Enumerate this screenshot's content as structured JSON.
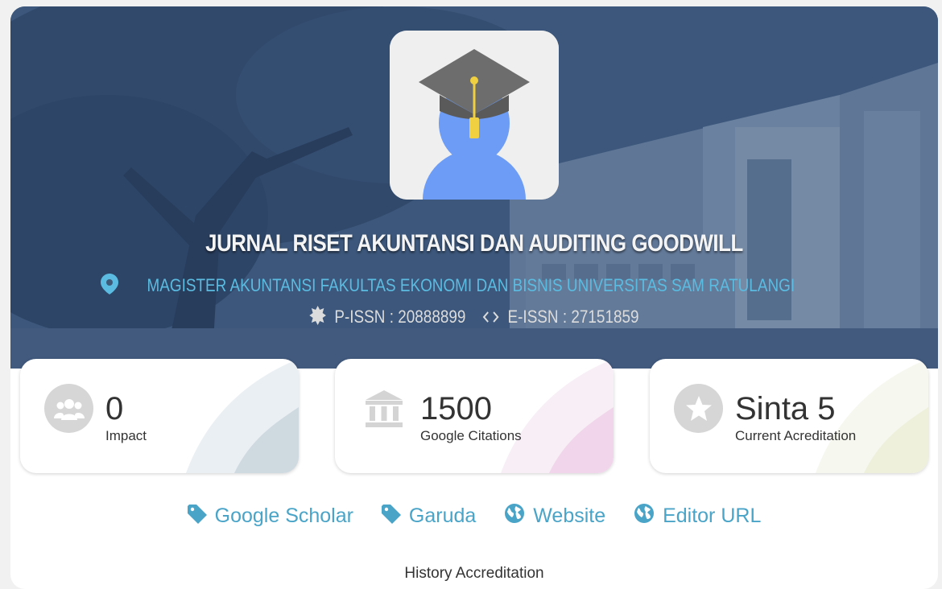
{
  "journal": {
    "title": "JURNAL RISET AKUNTANSI DAN AUDITING GOODWILL",
    "affiliation": "MAGISTER AKUNTANSI FAKULTAS EKONOMI DAN BISNIS UNIVERSITAS SAM RATULANGI",
    "p_issn": "P-ISSN : 20888899",
    "e_issn": "E-ISSN : 27151859"
  },
  "stats": [
    {
      "value": "0",
      "label": "Impact",
      "icon": "users-icon",
      "color": "#cfd9e0"
    },
    {
      "value": "1500",
      "label": "Google Citations",
      "icon": "bank-icon",
      "color": "#f1d5ea"
    },
    {
      "value": "Sinta 5",
      "label": "Current Acreditation",
      "icon": "star-icon",
      "color": "#eef0dc"
    }
  ],
  "links": [
    {
      "label": "Google Scholar",
      "icon": "tag-icon"
    },
    {
      "label": "Garuda",
      "icon": "tag-icon"
    },
    {
      "label": "Website",
      "icon": "globe-icon"
    },
    {
      "label": "Editor URL",
      "icon": "globe-icon"
    }
  ],
  "history_label": "History Accreditation",
  "colors": {
    "accent": "#49a4c8",
    "affiliation": "#5bbbe0",
    "hero": "#3f5a78"
  }
}
